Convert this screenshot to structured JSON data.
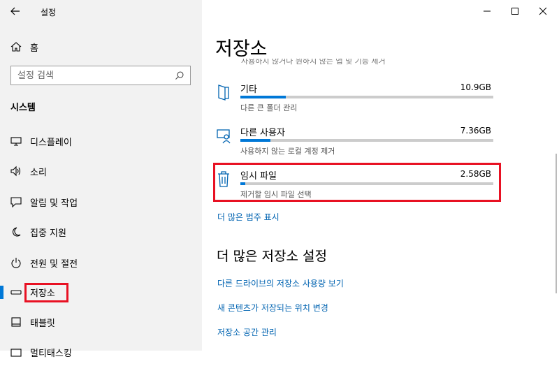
{
  "window": {
    "title": "설정"
  },
  "sidebar": {
    "home_label": "홈",
    "search_placeholder": "설정 검색",
    "section_title": "시스템",
    "items": [
      {
        "label": "디스플레이",
        "icon": "monitor-icon"
      },
      {
        "label": "소리",
        "icon": "speaker-icon"
      },
      {
        "label": "알림 및 작업",
        "icon": "notification-icon"
      },
      {
        "label": "집중 지원",
        "icon": "moon-icon"
      },
      {
        "label": "전원 및 절전",
        "icon": "power-icon"
      },
      {
        "label": "저장소",
        "icon": "storage-icon",
        "selected": true
      },
      {
        "label": "태블릿",
        "icon": "tablet-icon"
      },
      {
        "label": "멀티태스킹",
        "icon": "multitask-icon"
      }
    ]
  },
  "main": {
    "title": "저장소",
    "truncated_text": "사용하지 않거나 원하지 않는 앱 및 기능 제거",
    "categories": [
      {
        "name": "기타",
        "size": "10.9GB",
        "desc": "다른 큰 폴더 관리",
        "fill": 0.18,
        "icon": "folder-icon"
      },
      {
        "name": "다른 사용자",
        "size": "7.36GB",
        "desc": "사용하지 않는 로컬 계정 제거",
        "fill": 0.12,
        "icon": "user-account-icon"
      },
      {
        "name": "임시 파일",
        "size": "2.58GB",
        "desc": "제거할 임시 파일 선택",
        "fill": 0.02,
        "icon": "trash-icon"
      }
    ],
    "show_more_link": "더 많은 범주 표시",
    "more_settings_title": "더 많은 저장소 설정",
    "links": [
      "다른 드라이브의 저장소 사용량 보기",
      "새 콘텐츠가 저장되는 위치 변경",
      "저장소 공간 관리"
    ]
  },
  "colors": {
    "accent": "#0078d7",
    "link": "#0063b1",
    "highlight": "#e81123",
    "sidebar_bg": "#f2f2f2"
  }
}
